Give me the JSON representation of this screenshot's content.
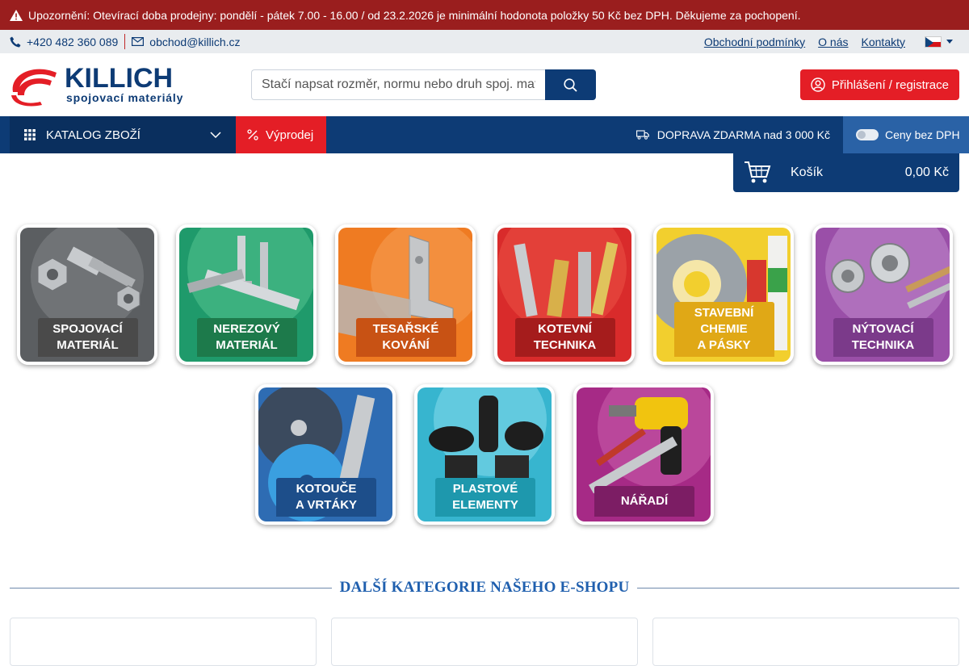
{
  "notice": {
    "text": "Upozornění: Otevírací doba prodejny: pondělí - pátek 7.00 - 16.00 / od 23.2.2026 je minimální hodonota položky 50 Kč bez DPH. Děkujeme za pochopení."
  },
  "contact": {
    "phone": "+420 482 360 089",
    "email": "obchod@killich.cz"
  },
  "toplinks": {
    "terms": "Obchodní podmínky",
    "about": "O nás",
    "contacts": "Kontakty"
  },
  "logo": {
    "brand": "KILLICH",
    "subtitle": "spojovací materiály"
  },
  "search": {
    "placeholder": "Stačí napsat rozměr, normu nebo druh spoj. materiálu"
  },
  "login": {
    "label": "Přihlášení / registrace"
  },
  "nav": {
    "catalog": "KATALOG ZBOŽÍ",
    "sale": "Výprodej",
    "shipping": "DOPRAVA ZDARMA nad 3 000 Kč",
    "vat_toggle": "Ceny bez DPH"
  },
  "cart": {
    "label": "Košík",
    "total": "0,00 Kč"
  },
  "categories": [
    {
      "title": "SPOJOVACÍ MATERIÁL",
      "line1": "SPOJOVACÍ",
      "line2": "MATERIÁL",
      "bg": "#5a5d60",
      "capbg": "#4a4a4a"
    },
    {
      "title": "NEREZOVÝ MATERIÁL",
      "line1": "NEREZOVÝ",
      "line2": "MATERIÁL",
      "bg": "#1e9a6a",
      "capbg": "#1d7a4b"
    },
    {
      "title": "TESAŘSKÉ KOVÁNÍ",
      "line1": "TESAŘSKÉ",
      "line2": "KOVÁNÍ",
      "bg": "#ef7b22",
      "capbg": "#c85214"
    },
    {
      "title": "KOTEVNÍ TECHNIKA",
      "line1": "KOTEVNÍ",
      "line2": "TECHNIKA",
      "bg": "#d92b2b",
      "capbg": "#a51c1c"
    },
    {
      "title": "STAVEBNÍ CHEMIE A PÁSKY",
      "line1": "STAVEBNÍ",
      "line2": "CHEMIE",
      "line3": "A PÁSKY",
      "bg": "#f2cf2e",
      "capbg": "#e0a816"
    },
    {
      "title": "NÝTOVACÍ TECHNIKA",
      "line1": "NÝTOVACÍ",
      "line2": "TECHNIKA",
      "bg": "#9a4fa8",
      "capbg": "#7b3a8a"
    },
    {
      "title": "KOTOUČE A VRTÁKY",
      "line1": "KOTOUČE",
      "line2": "A VRTÁKY",
      "bg": "#2e6cb3",
      "capbg": "#1d4e8a"
    },
    {
      "title": "PLASTOVÉ ELEMENTY",
      "line1": "PLASTOVÉ",
      "line2": "ELEMENTY",
      "bg": "#37b5cf",
      "capbg": "#1e98ad"
    },
    {
      "title": "NÁŘADÍ",
      "line1": "NÁŘADÍ",
      "line2": "",
      "bg": "#a62a86",
      "capbg": "#7c1d64"
    }
  ],
  "more": {
    "heading": "DALŠÍ KATEGORIE NAŠEHO E-SHOPU"
  }
}
